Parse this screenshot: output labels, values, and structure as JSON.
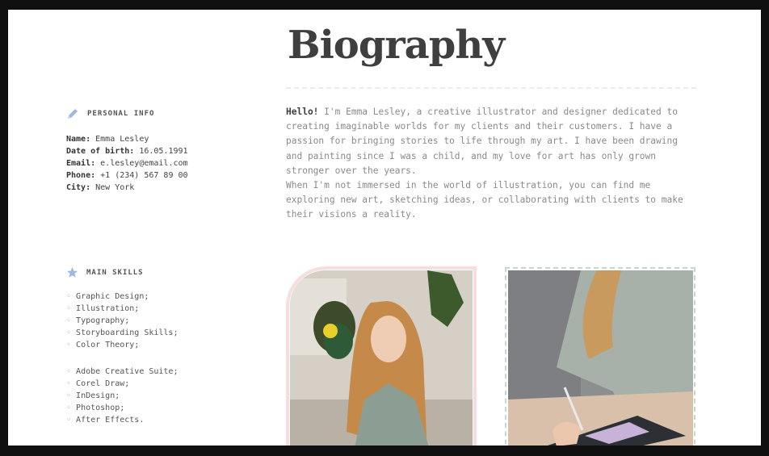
{
  "title": "Biography",
  "personal": {
    "heading": "PERSONAL INFO",
    "icon": "pencil-icon",
    "fields": [
      {
        "label": "Name:",
        "value": "Emma Lesley"
      },
      {
        "label": "Date of birth:",
        "value": "16.05.1991"
      },
      {
        "label": "Email:",
        "value": "e.lesley@email.com"
      },
      {
        "label": "Phone:",
        "value": "+1 (234) 567 89 00"
      },
      {
        "label": "City:",
        "value": "New York"
      }
    ]
  },
  "bio": {
    "greeting": "Hello!",
    "text": " I'm Emma Lesley, a creative illustrator and designer dedicated to\ncreating imaginable worlds for my clients and their customers. I have a\npassion for bringing stories to life through my art. I have been drawing\nand painting since I was a child, and my love for art has only grown\nstronger over the years.\nWhen I'm not immersed in the world of illustration, you can find me\nexploring new art, sketching ideas, or collaborating with clients to make\ntheir visions a reality."
  },
  "skills": {
    "heading": "MAIN SKILLS",
    "icon": "star-icon",
    "group1": [
      "Graphic Design;",
      "Illustration;",
      "Typography;",
      "Storyboarding Skills;",
      "Color Theory;"
    ],
    "group2": [
      "Adobe Creative Suite;",
      "Corel Draw;",
      "InDesign;",
      "Photoshop;",
      "After Effects."
    ]
  },
  "colors": {
    "title": "#3f3f3f",
    "icon_blue": "#9fb8dc",
    "photo_border_pink": "#f7dede",
    "photo_border_teal": "#c9d4d4"
  }
}
